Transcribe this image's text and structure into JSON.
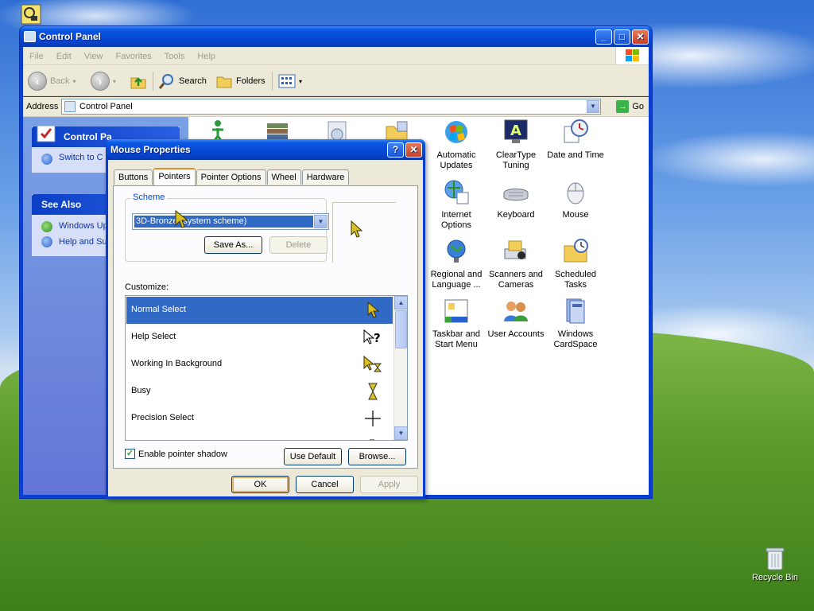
{
  "desktop": {
    "recycle_bin_label": "Recycle Bin"
  },
  "control_panel": {
    "title": "Control Panel",
    "menu": [
      "File",
      "Edit",
      "View",
      "Favorites",
      "Tools",
      "Help"
    ],
    "toolbar": {
      "back": "Back",
      "search": "Search",
      "folders": "Folders"
    },
    "address": {
      "label": "Address",
      "value": "Control Panel",
      "go": "Go"
    },
    "sidebar": {
      "panel_title": "Control Pa",
      "switch_link": "Switch to C",
      "see_also_title": "See Also",
      "see_also_links": [
        "Windows Up",
        "Help and Su"
      ]
    },
    "items": [
      {
        "label": "Automatic Updates",
        "icon": "automatic-updates-icon"
      },
      {
        "label": "ClearType Tuning",
        "icon": "cleartype-icon"
      },
      {
        "label": "Date and Time",
        "icon": "date-time-icon"
      },
      {
        "label": "Internet Options",
        "icon": "internet-options-icon"
      },
      {
        "label": "Keyboard",
        "icon": "keyboard-icon"
      },
      {
        "label": "Mouse",
        "icon": "mouse-icon"
      },
      {
        "label": "Regional and Language ...",
        "icon": "regional-icon"
      },
      {
        "label": "Scanners and Cameras",
        "icon": "scanner-icon"
      },
      {
        "label": "Scheduled Tasks",
        "icon": "scheduled-tasks-icon"
      },
      {
        "label": "Taskbar and Start Menu",
        "icon": "taskbar-icon"
      },
      {
        "label": "User Accounts",
        "icon": "user-accounts-icon"
      },
      {
        "label": "Windows CardSpace",
        "icon": "cardspace-icon"
      }
    ]
  },
  "dialog": {
    "title": "Mouse Properties",
    "tabs": [
      "Buttons",
      "Pointers",
      "Pointer Options",
      "Wheel",
      "Hardware"
    ],
    "active_tab": "Pointers",
    "scheme_label": "Scheme",
    "scheme_value": "3D-Bronze (system scheme)",
    "save_as": "Save As...",
    "delete": "Delete",
    "customize_label": "Customize:",
    "pointers": [
      {
        "name": "Normal Select",
        "selected": true
      },
      {
        "name": "Help Select",
        "selected": false
      },
      {
        "name": "Working In Background",
        "selected": false
      },
      {
        "name": "Busy",
        "selected": false
      },
      {
        "name": "Precision Select",
        "selected": false
      }
    ],
    "enable_shadow": "Enable pointer shadow",
    "shadow_checked": true,
    "use_default": "Use Default",
    "browse": "Browse...",
    "ok": "OK",
    "cancel": "Cancel",
    "apply": "Apply",
    "colors": {
      "selection": "#316ac5",
      "titlebar": "#0a56e3",
      "cursor_gold": "#d8c020"
    }
  }
}
